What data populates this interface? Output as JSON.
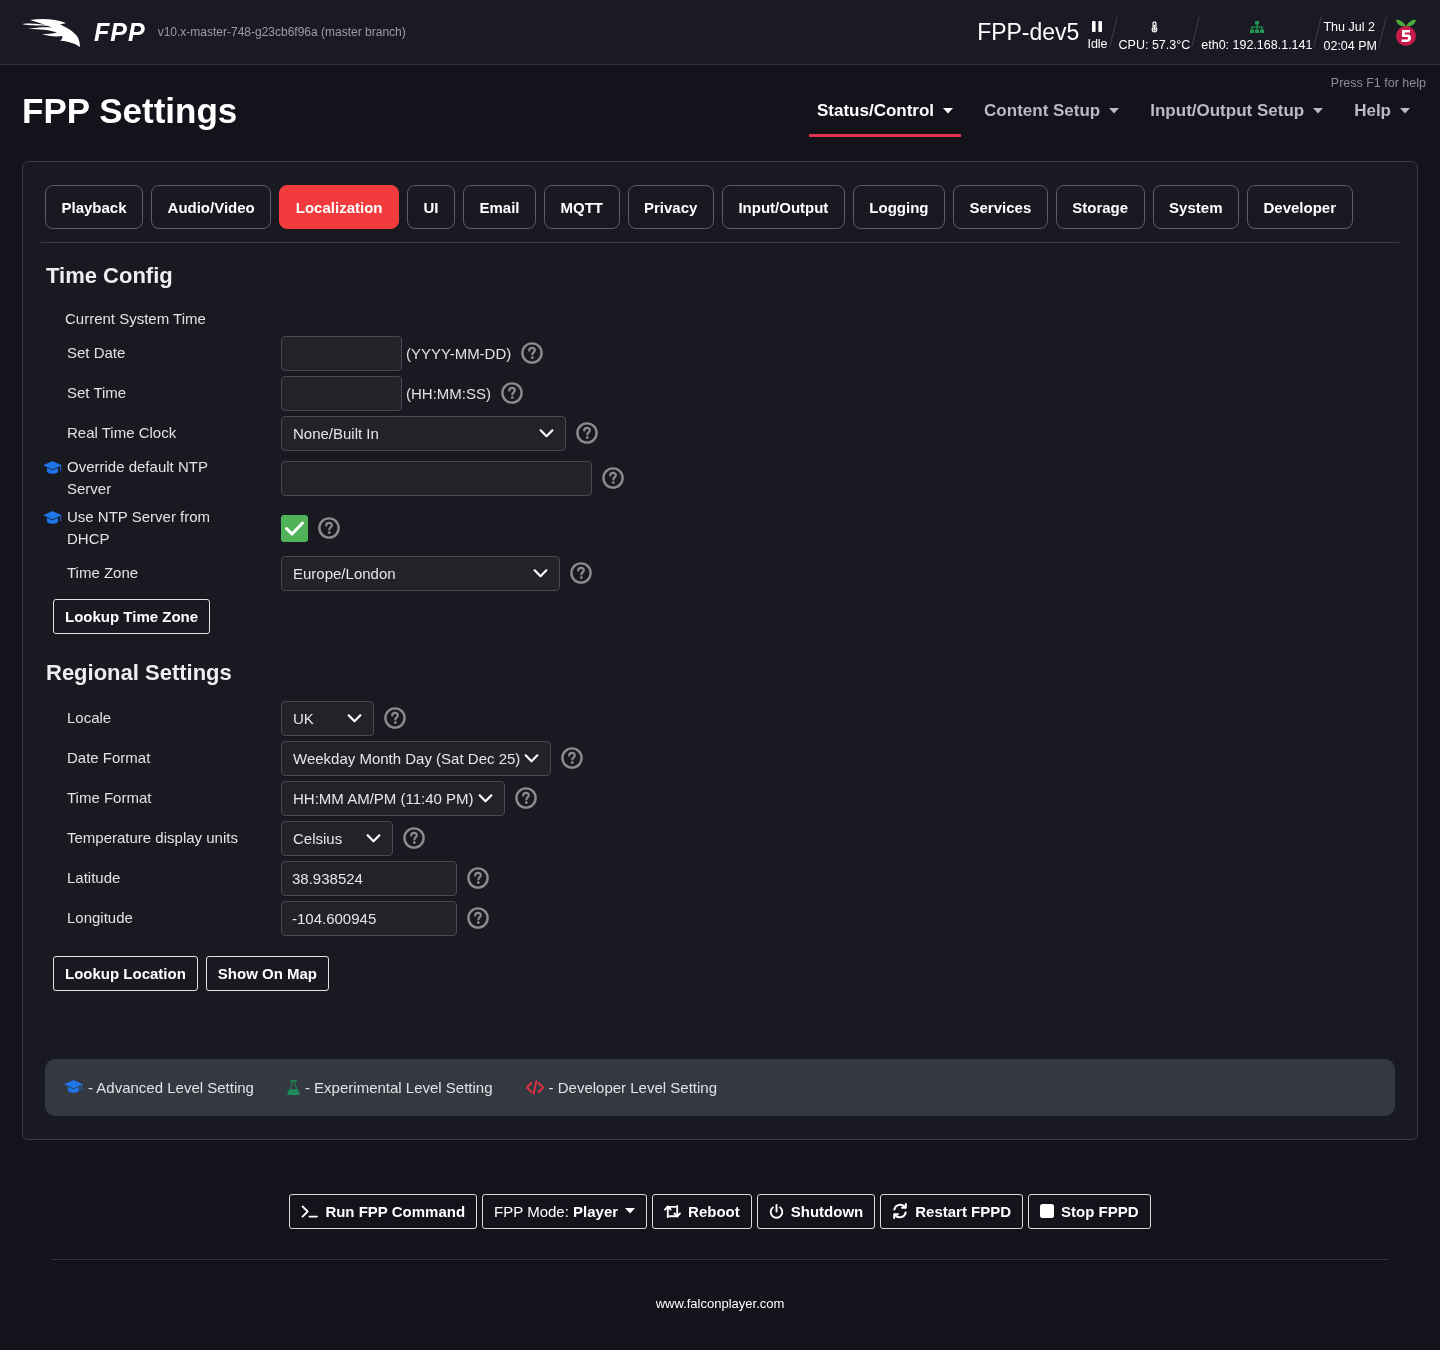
{
  "header": {
    "logo_text": "FPP",
    "version": "v10.x-master-748-g23cb6f96a (master branch)",
    "hostname": "FPP-dev5",
    "status": [
      {
        "kind": "player",
        "lines": [
          "Idle"
        ]
      },
      {
        "kind": "temperature",
        "lines": [
          "CPU: 57.3°C"
        ]
      },
      {
        "kind": "network",
        "lines": [
          "eth0: 192.168.1.141"
        ]
      },
      {
        "kind": "clock",
        "lines": [
          "Thu Jul 2",
          "02:04 PM"
        ]
      }
    ]
  },
  "help_hint": "Press F1 for help",
  "page_title": "FPP Settings",
  "nav": [
    {
      "label": "Status/Control",
      "selected": true
    },
    {
      "label": "Content Setup",
      "selected": false
    },
    {
      "label": "Input/Output Setup",
      "selected": false
    },
    {
      "label": "Help",
      "selected": false
    }
  ],
  "tabs": [
    {
      "label": "Playback",
      "selected": false
    },
    {
      "label": "Audio/Video",
      "selected": false
    },
    {
      "label": "Localization",
      "selected": true
    },
    {
      "label": "UI",
      "selected": false
    },
    {
      "label": "Email",
      "selected": false
    },
    {
      "label": "MQTT",
      "selected": false
    },
    {
      "label": "Privacy",
      "selected": false
    },
    {
      "label": "Input/Output",
      "selected": false
    },
    {
      "label": "Logging",
      "selected": false
    },
    {
      "label": "Services",
      "selected": false
    },
    {
      "label": "Storage",
      "selected": false
    },
    {
      "label": "System",
      "selected": false
    },
    {
      "label": "Developer",
      "selected": false
    }
  ],
  "sections": [
    {
      "title": "Time Config",
      "rows": [
        {
          "kind": "heading",
          "label": "Current System Time"
        },
        {
          "kind": "text",
          "label": "Set Date",
          "hint": "(YYYY-MM-DD)",
          "help": true
        },
        {
          "kind": "text",
          "label": "Set Time",
          "hint": "(HH:MM:SS)",
          "help": true
        },
        {
          "kind": "select",
          "label": "Real Time Clock",
          "value": "None/Built In",
          "help": true
        },
        {
          "kind": "text",
          "label": "Override default NTP Server",
          "advanced": true,
          "help": true
        },
        {
          "kind": "checkbox",
          "label": "Use NTP Server from DHCP",
          "advanced": true,
          "checked": true,
          "help": true
        },
        {
          "kind": "select",
          "label": "Time Zone",
          "value": "Europe/London",
          "help": true
        }
      ],
      "buttons": [
        "Lookup Time Zone"
      ]
    },
    {
      "title": "Regional Settings",
      "rows": [
        {
          "kind": "select",
          "label": "Locale",
          "value": "UK",
          "help": true
        },
        {
          "kind": "select",
          "label": "Date Format",
          "value": "Weekday Month Day (Sat Dec 25)",
          "help": true
        },
        {
          "kind": "select",
          "label": "Time Format",
          "value": "HH:MM AM/PM (11:40 PM)",
          "help": true
        },
        {
          "kind": "select",
          "label": "Temperature display units",
          "value": "Celsius",
          "help": true
        },
        {
          "kind": "text",
          "label": "Latitude",
          "value": "38.938524",
          "help": true
        },
        {
          "kind": "text",
          "label": "Longitude",
          "value": "-104.600945",
          "help": true
        }
      ],
      "buttons": [
        "Lookup Location",
        "Show On Map"
      ]
    }
  ],
  "legend": [
    {
      "kind": "advanced",
      "text": "- Advanced Level Setting"
    },
    {
      "kind": "experimental",
      "text": "- Experimental Level Setting"
    },
    {
      "kind": "developer",
      "text": "- Developer Level Setting"
    }
  ],
  "actions": [
    {
      "kind": "command",
      "label": "Run FPP Command"
    },
    {
      "kind": "mode",
      "label": "FPP Mode: **Player**"
    },
    {
      "kind": "reboot",
      "label": "Reboot"
    },
    {
      "kind": "shutdown",
      "label": "Shutdown"
    },
    {
      "kind": "restart",
      "label": "Restart FPPD"
    },
    {
      "kind": "stop",
      "label": "Stop FPPD"
    }
  ],
  "footer": {
    "link": "www.falconplayer.com"
  }
}
